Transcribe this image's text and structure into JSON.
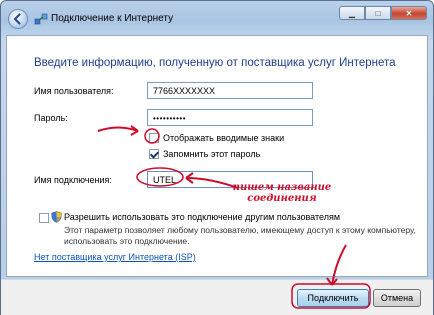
{
  "window": {
    "title": "Подключение к Интернету"
  },
  "page": {
    "heading": "Введите информацию, полученную от поставщика услуг Интернета"
  },
  "form": {
    "username_label": "Имя пользователя:",
    "username_value": "7766XXXXXXX",
    "password_label": "Пароль:",
    "password_value": "••••••••••",
    "show_chars_label": "Отображать вводимые знаки",
    "show_chars_checked": false,
    "remember_label": "Запомнить этот пароль",
    "remember_checked": true,
    "connection_label": "Имя подключения:",
    "connection_value": "UTEL",
    "share_label": "Разрешить использовать это подключение другим пользователям",
    "share_checked": false,
    "share_note": "Этот параметр позволяет любому пользователю, имеющему доступ к этому компьютеру, использовать это подключение."
  },
  "links": {
    "no_isp": "Нет поставщика услуг Интернета (ISP)"
  },
  "buttons": {
    "connect": "Подключить",
    "cancel": "Отмена"
  },
  "annotation": {
    "line1": "пишем название",
    "line2": "соединения",
    "color": "#cc0d2b"
  },
  "icons": {
    "back": "back-arrow-icon",
    "network": "network-icon",
    "shield": "uac-shield-icon"
  }
}
